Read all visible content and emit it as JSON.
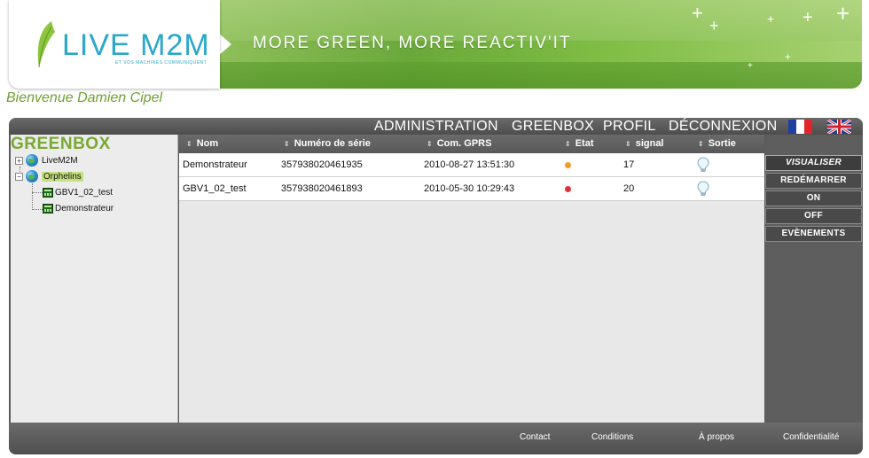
{
  "brand": {
    "logo_text": "LIVE M2M",
    "logo_tagline": "ET VOS MACHINES COMMUNIQUENT",
    "slogan": "MORE GREEN, MORE REACTIV'IT",
    "accent_color": "#2aa7c9",
    "green_color": "#79a833"
  },
  "welcome": "Bienvenue Damien Cipel",
  "nav": {
    "items": [
      {
        "label": "ADMINISTRATION"
      },
      {
        "label": "GREENBOX"
      },
      {
        "label": "PROFIL"
      },
      {
        "label": "DÉCONNEXION"
      }
    ],
    "flags": [
      "fr-flag",
      "uk-flag"
    ]
  },
  "sidebar": {
    "title": "GREENBOX",
    "tree": [
      {
        "label": "LiveM2M",
        "toggle": "+",
        "icon": "globe-icon"
      },
      {
        "label": "Orphelins",
        "toggle": "−",
        "icon": "globe-icon",
        "selected": true
      },
      {
        "label": "GBV1_02_test",
        "icon": "device-icon"
      },
      {
        "label": "Demonstrateur",
        "icon": "device-icon"
      }
    ]
  },
  "table": {
    "columns": [
      "Nom",
      "Numéro de série",
      "Com. GPRS",
      "Etat",
      "signal",
      "Sortie"
    ],
    "sort_icon": "⇕",
    "rows": [
      {
        "nom": "Demonstrateur",
        "serie": "357938020461935",
        "gprs": "2010-08-27 13:51:30",
        "etat_color": "#f39a2c",
        "signal": "17",
        "sortie": "bulb-icon"
      },
      {
        "nom": "GBV1_02_test",
        "serie": "357938020461893",
        "gprs": "2010-05-30 10:29:43",
        "etat_color": "#e0303a",
        "signal": "20",
        "sortie": "bulb-icon"
      }
    ]
  },
  "actions": {
    "buttons": [
      "VISUALISER",
      "REDÉMARRER",
      "ON",
      "OFF",
      "EVÈNEMENTS"
    ]
  },
  "footer": {
    "links": [
      "Contact",
      "Conditions",
      "À propos",
      "Confidentialité"
    ]
  }
}
